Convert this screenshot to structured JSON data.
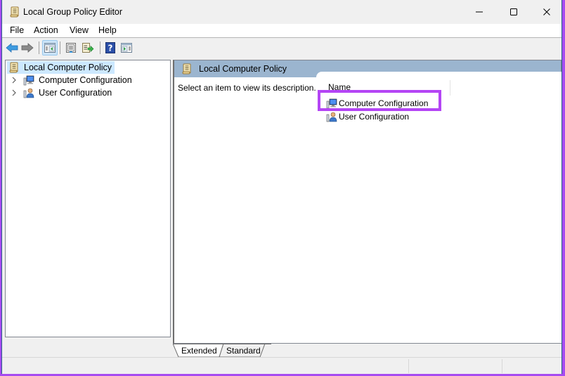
{
  "window": {
    "title": "Local Group Policy Editor",
    "controls": {
      "minimize": "minimize",
      "maximize": "maximize",
      "close": "close"
    }
  },
  "menu": {
    "items": [
      {
        "label": "File"
      },
      {
        "label": "Action"
      },
      {
        "label": "View"
      },
      {
        "label": "Help"
      }
    ]
  },
  "toolbar": {
    "buttons": [
      {
        "icon": "back-arrow-icon",
        "tooltip": "Back"
      },
      {
        "icon": "forward-arrow-icon",
        "tooltip": "Forward"
      },
      {
        "icon": "show-hide-console-tree-icon",
        "tooltip": "Show/Hide Console Tree",
        "active": true
      },
      {
        "icon": "properties-icon",
        "tooltip": "Properties"
      },
      {
        "icon": "export-list-icon",
        "tooltip": "Export List"
      },
      {
        "icon": "help-icon",
        "tooltip": "Help"
      },
      {
        "icon": "show-hide-action-pane-icon",
        "tooltip": "Show/Hide Action Pane"
      }
    ]
  },
  "tree": {
    "root": {
      "label": "Local Computer Policy",
      "selected": true
    },
    "children": [
      {
        "label": "Computer Configuration",
        "icon": "computer-config-icon",
        "expandable": true
      },
      {
        "label": "User Configuration",
        "icon": "user-config-icon",
        "expandable": true
      }
    ]
  },
  "details": {
    "header_title": "Local Computer Policy",
    "description": "Select an item to view its description.",
    "column_header": "Name",
    "items": [
      {
        "label": "Computer Configuration",
        "icon": "computer-config-icon",
        "highlighted": true
      },
      {
        "label": "User Configuration",
        "icon": "user-config-icon"
      }
    ],
    "highlight_color": "#b445f5"
  },
  "tabs": [
    {
      "label": "Extended",
      "active": true
    },
    {
      "label": "Standard",
      "active": false
    }
  ],
  "colors": {
    "header_bar": "#9bb5cf",
    "selection": "#cce8ff",
    "outer_border": "#a64cf0"
  }
}
